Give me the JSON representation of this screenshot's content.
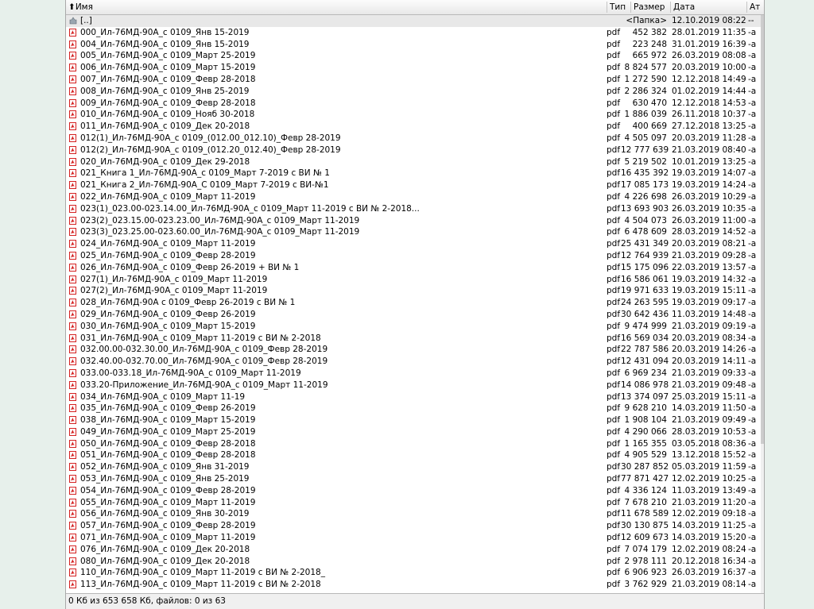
{
  "columns": {
    "sort_arrow": "⬆",
    "name": "Имя",
    "type": "Тип",
    "size": "Размер",
    "date": "Дата",
    "attr": "Ат"
  },
  "files": [
    {
      "name": "[..]",
      "ext": "",
      "size": "<Папка>",
      "date": "12.10.2019 08:22",
      "attr": "--",
      "icon": "folder-up-icon"
    },
    {
      "name": "000_Ил-76МД-90А_с 0109_Янв 15-2019",
      "ext": "pdf",
      "size": "452 382",
      "date": "28.01.2019 11:35",
      "attr": "-a",
      "icon": "pdf-icon"
    },
    {
      "name": "004_Ил-76МД-90А_с 0109_Янв 15-2019",
      "ext": "pdf",
      "size": "223 248",
      "date": "31.01.2019 16:39",
      "attr": "-a",
      "icon": "pdf-icon"
    },
    {
      "name": "005_Ил-76МД-90А_с 0109_Март 25-2019",
      "ext": "pdf",
      "size": "665 972",
      "date": "26.03.2019 08:08",
      "attr": "-a",
      "icon": "pdf-icon"
    },
    {
      "name": "006_Ил-76МД-90А_с 0109_Март 15-2019",
      "ext": "pdf",
      "size": "8 824 577",
      "date": "20.03.2019 10:00",
      "attr": "-a",
      "icon": "pdf-icon"
    },
    {
      "name": "007_Ил-76МД-90А_с 0109_Февр 28-2018",
      "ext": "pdf",
      "size": "1 272 590",
      "date": "12.12.2018 14:49",
      "attr": "-a",
      "icon": "pdf-icon"
    },
    {
      "name": "008_Ил-76МД-90А_с 0109_Янв 25-2019",
      "ext": "pdf",
      "size": "2 286 324",
      "date": "01.02.2019 14:44",
      "attr": "-a",
      "icon": "pdf-icon"
    },
    {
      "name": "009_Ил-76МД-90А_с 0109_Февр 28-2018",
      "ext": "pdf",
      "size": "630 470",
      "date": "12.12.2018 14:53",
      "attr": "-a",
      "icon": "pdf-icon"
    },
    {
      "name": "010_Ил-76МД-90А_с 0109_Нояб 30-2018",
      "ext": "pdf",
      "size": "1 886 039",
      "date": "26.11.2018 10:37",
      "attr": "-a",
      "icon": "pdf-icon"
    },
    {
      "name": "011_Ил-76МД-90А_с 0109_Дек 20-2018",
      "ext": "pdf",
      "size": "400 669",
      "date": "27.12.2018 13:25",
      "attr": "-a",
      "icon": "pdf-icon"
    },
    {
      "name": "012(1)_Ил-76МД-90А_с 0109_(012.00_012.10)_Февр 28-2019",
      "ext": "pdf",
      "size": "4 505 097",
      "date": "20.03.2019 11:28",
      "attr": "-a",
      "icon": "pdf-icon"
    },
    {
      "name": "012(2)_Ил-76МД-90А_с 0109_(012.20_012.40)_Февр 28-2019",
      "ext": "pdf",
      "size": "12 777 639",
      "date": "21.03.2019 08:40",
      "attr": "-a",
      "icon": "pdf-icon"
    },
    {
      "name": "020_Ил-76МД-90А_с 0109_Дек 29-2018",
      "ext": "pdf",
      "size": "5 219 502",
      "date": "10.01.2019 13:25",
      "attr": "-a",
      "icon": "pdf-icon"
    },
    {
      "name": "021_Книга 1_Ил-76МД-90А_с 0109_Март 7-2019 с ВИ № 1",
      "ext": "pdf",
      "size": "16 435 392",
      "date": "19.03.2019 14:07",
      "attr": "-a",
      "icon": "pdf-icon"
    },
    {
      "name": "021_Книга 2_Ил-76МД-90А_С 0109_Март 7-2019 с ВИ-№1",
      "ext": "pdf",
      "size": "17 085 173",
      "date": "19.03.2019 14:24",
      "attr": "-a",
      "icon": "pdf-icon"
    },
    {
      "name": "022_Ил-76МД-90А_с 0109_Март 11-2019",
      "ext": "pdf",
      "size": "4 226 698",
      "date": "26.03.2019 10:29",
      "attr": "-a",
      "icon": "pdf-icon"
    },
    {
      "name": "023(1)_023.00-023.14.00_Ил-76МД-90А_с 0109_Март 11-2019 с ВИ № 2-2018...",
      "ext": "pdf",
      "size": "13 693 903",
      "date": "26.03.2019 10:35",
      "attr": "-a",
      "icon": "pdf-icon"
    },
    {
      "name": "023(2)_023.15.00-023.23.00_Ил-76МД-90А_с 0109_Март 11-2019",
      "ext": "pdf",
      "size": "4 504 073",
      "date": "26.03.2019 11:00",
      "attr": "-a",
      "icon": "pdf-icon"
    },
    {
      "name": "023(3)_023.25.00-023.60.00_Ил-76МД-90А_с 0109_Март 11-2019",
      "ext": "pdf",
      "size": "6 478 609",
      "date": "28.03.2019 14:52",
      "attr": "-a",
      "icon": "pdf-icon"
    },
    {
      "name": "024_Ил-76МД-90А_с 0109_Март 11-2019",
      "ext": "pdf",
      "size": "25 431 349",
      "date": "20.03.2019 08:21",
      "attr": "-a",
      "icon": "pdf-icon"
    },
    {
      "name": "025_Ил-76МД-90А_с 0109_Февр 28-2019",
      "ext": "pdf",
      "size": "12 764 939",
      "date": "21.03.2019 09:28",
      "attr": "-a",
      "icon": "pdf-icon"
    },
    {
      "name": "026_Ил-76МД-90А_с 0109_Февр 26-2019 +  ВИ № 1",
      "ext": "pdf",
      "size": "15 175 096",
      "date": "22.03.2019 13:57",
      "attr": "-a",
      "icon": "pdf-icon"
    },
    {
      "name": "027(1)_Ил-76МД-90А_с 0109_Март 11-2019",
      "ext": "pdf",
      "size": "16 586 061",
      "date": "19.03.2019 14:32",
      "attr": "-a",
      "icon": "pdf-icon"
    },
    {
      "name": "027(2)_Ил-76МД-90А_с 0109_Март 11-2019",
      "ext": "pdf",
      "size": "19 971 633",
      "date": "19.03.2019 15:11",
      "attr": "-a",
      "icon": "pdf-icon"
    },
    {
      "name": "028_Ил-76МД-90А с 0109_Февр 26-2019 с ВИ № 1",
      "ext": "pdf",
      "size": "24 263 595",
      "date": "19.03.2019 09:17",
      "attr": "-a",
      "icon": "pdf-icon"
    },
    {
      "name": "029_Ил-76МД-90А_с 0109_Февр 26-2019",
      "ext": "pdf",
      "size": "30 642 436",
      "date": "11.03.2019 14:48",
      "attr": "-a",
      "icon": "pdf-icon"
    },
    {
      "name": "030_Ил-76МД-90А_с 0109_Март 15-2019",
      "ext": "pdf",
      "size": "9 474 999",
      "date": "21.03.2019 09:19",
      "attr": "-a",
      "icon": "pdf-icon"
    },
    {
      "name": "031_Ил-76МД-90А_с 0109_Март 11-2019 с ВИ № 2-2018",
      "ext": "pdf",
      "size": "16 569 034",
      "date": "20.03.2019 08:34",
      "attr": "-a",
      "icon": "pdf-icon"
    },
    {
      "name": "032.00.00-032.30.00_Ил-76МД-90А_с 0109_Февр 28-2019",
      "ext": "pdf",
      "size": "22 787 586",
      "date": "20.03.2019 14:26",
      "attr": "-a",
      "icon": "pdf-icon"
    },
    {
      "name": "032.40.00-032.70.00_Ил-76МД-90А_с 0109_Февр 28-2019",
      "ext": "pdf",
      "size": "12 431 094",
      "date": "20.03.2019 14:11",
      "attr": "-a",
      "icon": "pdf-icon"
    },
    {
      "name": "033.00-033.18_Ил-76МД-90А_с 0109_Март 11-2019",
      "ext": "pdf",
      "size": "6 969 234",
      "date": "21.03.2019 09:33",
      "attr": "-a",
      "icon": "pdf-icon"
    },
    {
      "name": "033.20-Приложение_Ил-76МД-90А_с 0109_Март 11-2019",
      "ext": "pdf",
      "size": "14 086 978",
      "date": "21.03.2019 09:48",
      "attr": "-a",
      "icon": "pdf-icon"
    },
    {
      "name": "034_Ил-76МД-90А_с 0109_Март 11-19",
      "ext": "pdf",
      "size": "13 374 097",
      "date": "25.03.2019 15:11",
      "attr": "-a",
      "icon": "pdf-icon"
    },
    {
      "name": "035_Ил-76МД-90А_с 0109_Февр 26-2019",
      "ext": "pdf",
      "size": "9 628 210",
      "date": "14.03.2019 11:50",
      "attr": "-a",
      "icon": "pdf-icon"
    },
    {
      "name": "038_Ил-76МД-90А_с 0109_Март 15-2019",
      "ext": "pdf",
      "size": "1 908 104",
      "date": "21.03.2019 09:49",
      "attr": "-a",
      "icon": "pdf-icon"
    },
    {
      "name": "049_Ил-76МД-90А_с  0109_Март 25-2019",
      "ext": "pdf",
      "size": "4 290 066",
      "date": "28.03.2019 10:53",
      "attr": "-a",
      "icon": "pdf-icon"
    },
    {
      "name": "050_Ил-76МД-90А_с 0109_Февр 28-2018",
      "ext": "pdf",
      "size": "1 165 355",
      "date": "03.05.2018 08:36",
      "attr": "-a",
      "icon": "pdf-icon"
    },
    {
      "name": "051_Ил-76МД-90А_с 0109_Февр 28-2018",
      "ext": "pdf",
      "size": "4 905 529",
      "date": "13.12.2018 15:52",
      "attr": "-a",
      "icon": "pdf-icon"
    },
    {
      "name": "052_Ил-76МД-90А_с 0109_Янв 31-2019",
      "ext": "pdf",
      "size": "30 287 852",
      "date": "05.03.2019 11:59",
      "attr": "-a",
      "icon": "pdf-icon"
    },
    {
      "name": "053_Ил-76МД-90А_с 0109_Янв 25-2019",
      "ext": "pdf",
      "size": "77 871 427",
      "date": "12.02.2019 10:25",
      "attr": "-a",
      "icon": "pdf-icon"
    },
    {
      "name": "054_Ил-76МД-90А_с 0109_Февр 28-2019",
      "ext": "pdf",
      "size": "4 336 124",
      "date": "11.03.2019 13:49",
      "attr": "-a",
      "icon": "pdf-icon"
    },
    {
      "name": "055_Ил-76МД-90А_с 0109_Март 11-2019",
      "ext": "pdf",
      "size": "7 678 210",
      "date": "21.03.2019 11:20",
      "attr": "-a",
      "icon": "pdf-icon"
    },
    {
      "name": "056_Ил-76МД-90А_с 0109_Янв 30-2019",
      "ext": "pdf",
      "size": "11 678 589",
      "date": "12.02.2019 09:18",
      "attr": "-a",
      "icon": "pdf-icon"
    },
    {
      "name": "057_Ил-76МД-90А_с 0109_Февр 28-2019",
      "ext": "pdf",
      "size": "30 130 875",
      "date": "14.03.2019 11:25",
      "attr": "-a",
      "icon": "pdf-icon"
    },
    {
      "name": "071_Ил-76МД-90А_с 0109_Март 11-2019",
      "ext": "pdf",
      "size": "12 609 673",
      "date": "14.03.2019 15:20",
      "attr": "-a",
      "icon": "pdf-icon"
    },
    {
      "name": "076_Ил-76МД-90А_с  0109_Дек 20-2018",
      "ext": "pdf",
      "size": "7 074 179",
      "date": "12.02.2019 08:24",
      "attr": "-a",
      "icon": "pdf-icon"
    },
    {
      "name": "080_Ил-76МД-90А_с  0109_Дек 20-2018",
      "ext": "pdf",
      "size": "2 978 111",
      "date": "20.12.2018 16:34",
      "attr": "-a",
      "icon": "pdf-icon"
    },
    {
      "name": "110_Ил-76МД-90А_с 0109_Март 11-2019 с ВИ № 2-2018_",
      "ext": "pdf",
      "size": "6 906 923",
      "date": "26.03.2019 16:37",
      "attr": "-a",
      "icon": "pdf-icon"
    },
    {
      "name": "113_Ил-76МД-90А_с 0109_Март 11-2019 с ВИ № 2-2018",
      "ext": "pdf",
      "size": "3 762 929",
      "date": "21.03.2019 08:14",
      "attr": "-a",
      "icon": "pdf-icon"
    }
  ],
  "status": {
    "text": "0 Кб из 653 658 Кб, файлов: 0 из 63"
  }
}
